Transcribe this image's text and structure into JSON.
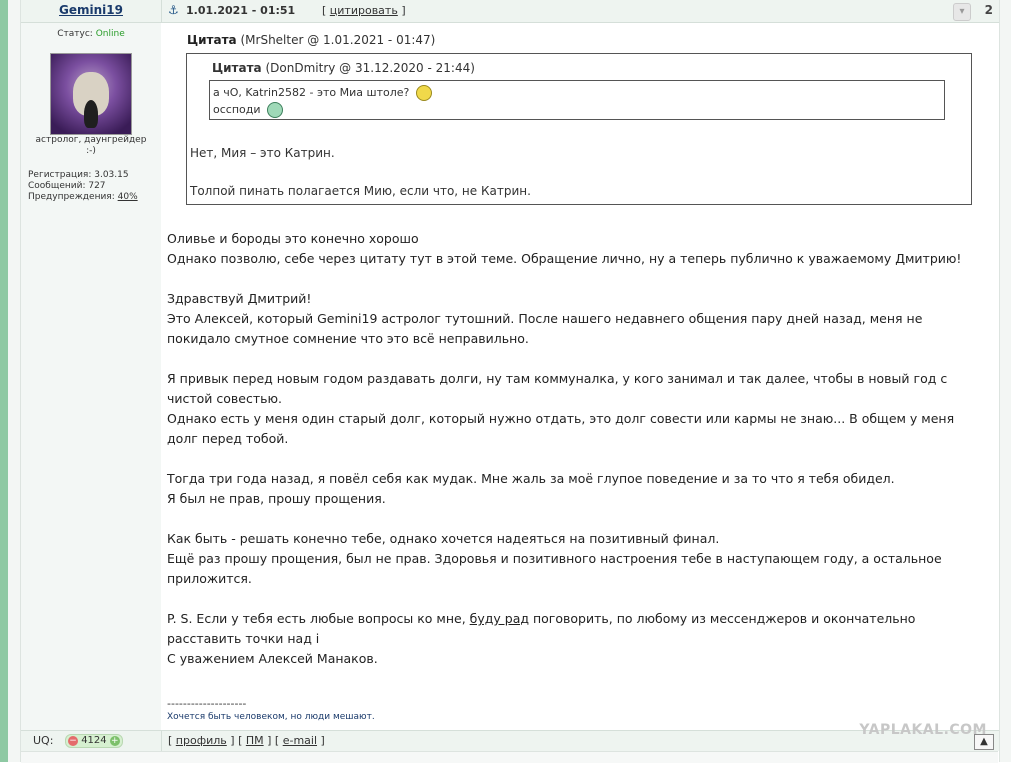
{
  "post": {
    "username": "Gemini19",
    "date": "1.01.2021 - 01:51",
    "cite_label": "цитировать",
    "vote_count": "2"
  },
  "user": {
    "status_label": "Статус:",
    "status_value": "Online",
    "avatar_caption": "астролог, даунгрейдер",
    "avatar_caption2": ":-)",
    "reg": "Регистрация: 3.03.15",
    "posts": "Сообщений: 727",
    "warn_label": "Предупреждения:",
    "warn_value": "40%"
  },
  "quote": {
    "outer_title": "Цитата",
    "outer_meta": "(MrShelter @ 1.01.2021 - 01:47)",
    "inner_title": "Цитата",
    "inner_meta": "(DonDmitry @ 31.12.2020 - 21:44)",
    "inner_line1": "а чО, Katrin2582 - это Миа штоле?",
    "inner_line2": "оссподи",
    "outer_line1": "Нет, Мия – это Катрин.",
    "outer_line2": "Толпой пинать полагается Мию, если что, не Катрин."
  },
  "body": {
    "l1": "Оливье и бороды это конечно хорошо",
    "l2": "Однако позволю, себе через цитату тут в этой теме. Обращение лично, ну а теперь публично к уважаемому Дмитрию!",
    "l3": "Здравствуй Дмитрий!",
    "l4": "Это Алексей, который Gemini19 астролог тутошний. После нашего недавнего общения пару дней назад, меня не",
    "l5": "покидало смутное сомнение что это всё неправильно.",
    "l6": "Я привык перед новым годом раздавать долги, ну там коммуналка, у кого занимал и так далее, чтобы в новый год с",
    "l7": "чистой совестью.",
    "l8": "Однако есть у меня один старый долг, который нужно отдать, это долг совести или кармы не знаю... В общем у меня",
    "l9": "долг перед тобой.",
    "l10": "Тогда три года назад, я повёл себя как мудак. Мне жаль за моё глупое поведение и за то что я тебя обидел.",
    "l11": "Я был не прав, прошу прощения.",
    "l12": "Как быть - решать конечно тебе, однако хочется надеяться на позитивный финал.",
    "l13": "Ещё раз прошу прощения, был не прав. Здоровья и позитивного настроения тебе в наступающем году, а остальное",
    "l14": "приложится.",
    "l15a": "P. S. Если у тебя есть любые вопросы ко мне, ",
    "l15b": "буду рад",
    "l15c": " поговорить, по любому из мессенджеров и окончательно",
    "l16": "расставить точки над i",
    "l17": "С уважением Алексей Манаков."
  },
  "signature": {
    "dashes": "--------------------",
    "text": "Хочется быть человеком, но люди мешают."
  },
  "footer": {
    "uq_label": "UQ:",
    "uq_value": "4124",
    "profile": "профиль",
    "pm": "ПМ",
    "email": "e-mail",
    "watermark": "YAPLAKAL.COM"
  }
}
